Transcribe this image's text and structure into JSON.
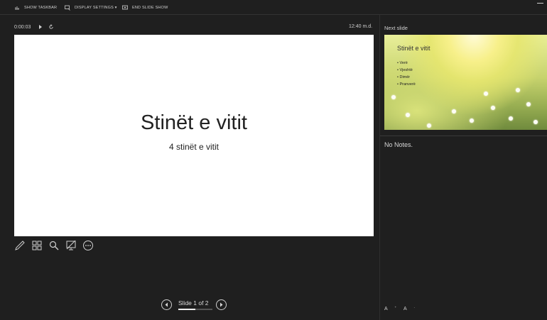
{
  "toolbar": {
    "show_taskbar": "SHOW TASKBAR",
    "display_settings": "DISPLAY SETTINGS ▾",
    "end_slide_show": "END SLIDE SHOW"
  },
  "timer": {
    "elapsed": "0:00:03",
    "clock": "12:40 m.d."
  },
  "current_slide": {
    "title": "Stinët e vitit",
    "subtitle": "4 stinët e vitit"
  },
  "next_slide": {
    "label": "Next slide",
    "title": "Stinët e vitit",
    "bullets": [
      "Verë",
      "Vjeshtë",
      "Dimër",
      "Pranverë"
    ]
  },
  "notes": "No Notes.",
  "navigation": {
    "slide_counter": "Slide 1 of 2",
    "progress": 0.5
  },
  "font_controls": {
    "increase": "A",
    "decrease": "A"
  },
  "colors": {
    "background": "#1f1f1f",
    "slide_bg": "#ffffff",
    "text": "#e6e6e6"
  },
  "icons": [
    "pen-icon",
    "see-all-slides-icon",
    "zoom-icon",
    "black-screen-icon",
    "more-options-icon",
    "previous-icon",
    "next-icon",
    "play-icon",
    "reset-icon"
  ]
}
